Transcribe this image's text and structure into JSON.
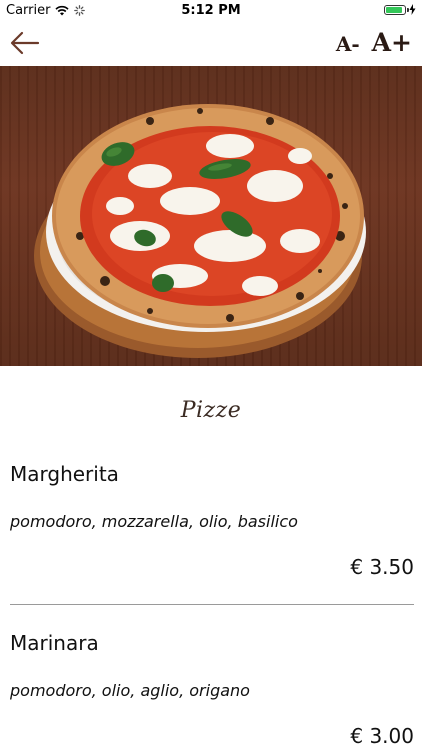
{
  "status_bar": {
    "carrier": "Carrier",
    "time": "5:12 PM",
    "battery_level": 0.9
  },
  "nav": {
    "back_icon": "arrow-left-icon",
    "font_decrease_label": "A-",
    "font_increase_label": "A+"
  },
  "hero": {
    "image": "pizza-margherita-photo"
  },
  "section": {
    "title": "Pizze"
  },
  "menu": {
    "items": [
      {
        "name": "Margherita",
        "ingredients": "pomodoro, mozzarella, olio, basilico",
        "price": "€ 3.50"
      },
      {
        "name": "Marinara",
        "ingredients": "pomodoro, olio, aglio, origano",
        "price": "€ 3.00"
      }
    ]
  },
  "colors": {
    "accent_brown": "#6b3a2a",
    "divider": "#9a9a9a",
    "battery": "#34c759"
  }
}
